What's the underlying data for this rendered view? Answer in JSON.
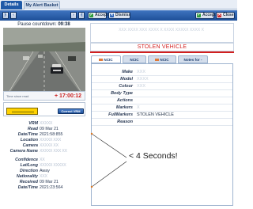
{
  "tabs": [
    {
      "label": "Details",
      "active": true
    },
    {
      "label": "My Alert Basket",
      "active": false
    }
  ],
  "toolbar": {
    "accept_label": "Accept",
    "dismiss_label": "Dismiss",
    "accept_right_label": "Accept",
    "close_label": "Close",
    "nav_icons": [
      "first-icon",
      "prev-icon",
      "next-icon",
      "last-icon"
    ]
  },
  "pause": {
    "label": "Pause countdown:",
    "value": "09:38"
  },
  "camera": {
    "caption_label": "Time since read",
    "timer": "+ 17:00:12"
  },
  "plate": {
    "correct_label": "Correct VRM"
  },
  "details": [
    {
      "key": "VRM",
      "value": "XXXXX",
      "blurred": true
    },
    {
      "key": "Read",
      "value": "09 Mar 21",
      "blurred": false
    },
    {
      "key": "Date/Time",
      "value": "2021:58:855",
      "blurred": false
    },
    {
      "key": "Location",
      "value": "XXXXX XXX",
      "blurred": true
    },
    {
      "key": "Camera",
      "value": "XXXXX XX",
      "blurred": true
    },
    {
      "key": "Camera Name",
      "value": "XXXXX XXX XX",
      "blurred": true
    },
    {
      "key": "Confidence",
      "value": "XX",
      "blurred": true
    },
    {
      "key": "Lat/Long",
      "value": "XXXXX XXXXX",
      "blurred": true
    },
    {
      "key": "Direction",
      "value": "Away",
      "blurred": false
    },
    {
      "key": "Nationality",
      "value": "XXX",
      "blurred": true
    },
    {
      "key": "Received",
      "value": "09 Mar 21",
      "blurred": false
    },
    {
      "key": "Date/Time",
      "value": "2021:23:564",
      "blurred": false
    }
  ],
  "alert": {
    "header_blurred": "XXX XXXX XXX XXXX X XXXX XXXXX XXXX X",
    "stolen_label": "STOLEN VEHICLE",
    "status_color": "#d21f1f"
  },
  "right_tabs": [
    {
      "label": "NCIC"
    },
    {
      "label": "NCIC"
    },
    {
      "label": "NCIC"
    },
    {
      "label": "Notes for -"
    }
  ],
  "right_rows": [
    {
      "key": "Make",
      "value": "XXX",
      "blurred": true
    },
    {
      "key": "Model",
      "value": "XXXX",
      "blurred": true
    },
    {
      "key": "Colour",
      "value": "XXX",
      "blurred": true
    },
    {
      "key": "Body Type",
      "value": "",
      "blurred": false
    },
    {
      "key": "Actions",
      "value": "",
      "blurred": false
    },
    {
      "key": "Markers",
      "value": "X",
      "blurred": true
    },
    {
      "key": "FullMarkers",
      "value": "STOLEN VEHICLE",
      "blurred": false
    },
    {
      "key": "Reason",
      "value": "",
      "blurred": false
    }
  ],
  "annotation": {
    "text": "< 4 Seconds!",
    "color": "#1a1a1a"
  }
}
